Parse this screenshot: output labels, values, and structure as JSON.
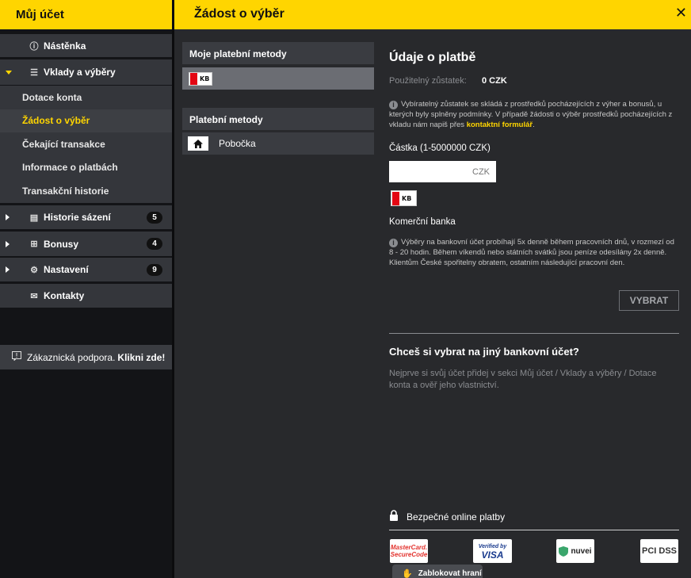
{
  "left_panel": {
    "title": "Můj účet",
    "items": [
      {
        "label": "Nástěnka"
      },
      {
        "label": "Vklady a výběry"
      },
      {
        "label": "Historie sázení",
        "count": "5"
      },
      {
        "label": "Bonusy",
        "count": "4"
      },
      {
        "label": "Nastavení",
        "count": "9"
      },
      {
        "label": "Kontakty"
      }
    ],
    "sub_items": [
      {
        "label": "Dotace konta"
      },
      {
        "label": "Žádost o výběr"
      },
      {
        "label": "Čekající transakce"
      },
      {
        "label": "Informace o platbách"
      },
      {
        "label": "Transakční historie"
      }
    ],
    "support_text": "Zákaznická podpora.",
    "support_link": "Klikni zde!"
  },
  "right_header": {
    "title": "Žádost o výběr",
    "close": "✕"
  },
  "methods": {
    "my_methods_title": "Moje platební metody",
    "methods_title": "Platební metody",
    "branch_label": "Pobočka",
    "kb_logo_text": "KB"
  },
  "payment": {
    "title": "Údaje o platbě",
    "balance_label": "Použitelný zůstatek:",
    "balance_value": "0 CZK",
    "info_note_text": "Vybíratelný zůstatek se skládá z prostředků pocházejících z výher a bonusů, u kterých byly splněny podmínky. V případě žádosti o výběr prostředků pocházejících z vkladu nám napiš přes",
    "info_note_link": "kontaktní formulář",
    "info_note_end": ".",
    "amount_label": "Částka (1-5000000 CZK)",
    "amount_placeholder": "CZK",
    "bank_name": "Komerční banka",
    "withdraw_note": "Výběry na bankovní účet probíhají 5x denně během pracovních dnů, v rozmezí od 8 - 20 hodin. Během víkendů nebo státních svátků jsou peníze odesílány 2x denně. Klientům České spořitelny obratem, ostatním následující pracovní den.",
    "withdraw_button": "VYBRAT"
  },
  "other_account": {
    "title": "Chceš si vybrat na jiný bankovní účet?",
    "text": "Nejprve si svůj účet přidej v sekci Můj účet / Vklady a výběry / Dotace konta a ověř jeho vlastnictví."
  },
  "secure": {
    "label": "Bezpečné online platby",
    "logos": {
      "mastercard": "MasterCard. SecureCode",
      "visa_small": "Verified by",
      "visa": "VISA",
      "nuvei": "nuvei",
      "pci": "PCI DSS"
    }
  },
  "block_button": "Zablokovat hraní",
  "colors": {
    "accent": "#ffd500",
    "panel": "#34363b",
    "background": "#28292c"
  }
}
